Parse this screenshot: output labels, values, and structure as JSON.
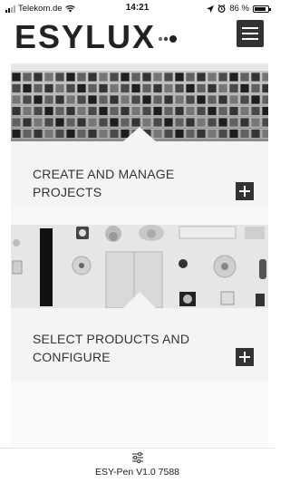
{
  "statusbar": {
    "carrier": "Telekom.de",
    "time": "14:21",
    "battery_percent": "86 %",
    "battery_level": 0.86,
    "icons": [
      "signal-icon",
      "wifi-icon",
      "location-arrow-icon",
      "alarm-icon",
      "battery-icon"
    ]
  },
  "header": {
    "logo_text": "ESYLUX",
    "menu_icon": "hamburger-menu-icon"
  },
  "cards": [
    {
      "title_line1": "CREATE AND MANAGE",
      "title_line2": "PROJECTS",
      "image": "office-building-facade-photo",
      "action_icon": "plus-icon"
    },
    {
      "title_line1": "SELECT PRODUCTS AND",
      "title_line2": "CONFIGURE",
      "image": "products-collage-photo",
      "action_icon": "plus-icon"
    }
  ],
  "footer": {
    "icon": "sliders-icon",
    "version": "ESY-Pen V1.0 7588"
  },
  "colors": {
    "card_background": "#f4f4f4",
    "button_dark": "#333333",
    "text": "#333333"
  }
}
